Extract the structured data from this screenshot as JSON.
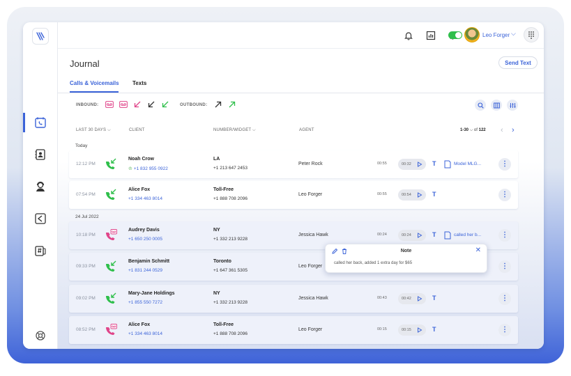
{
  "user": {
    "name": "Leo Forger"
  },
  "header": {
    "title": "Journal",
    "send_text": "Send Text"
  },
  "tabs": [
    {
      "label": "Calls & Voicemails",
      "active": true
    },
    {
      "label": "Texts",
      "active": false
    }
  ],
  "filters": {
    "inbound_label": "INBOUND:",
    "outbound_label": "OUTBOUND:"
  },
  "columns": {
    "period": "LAST 30 DAYS",
    "client": "CLIENT",
    "number": "NUMBER/WIDGET",
    "agent": "AGENT"
  },
  "pager": {
    "range": "1-30",
    "of_label": "of",
    "total": "122"
  },
  "groups": {
    "today": "Today",
    "date": "24 Jul 2022"
  },
  "rows": [
    {
      "time": "12:12 PM",
      "type": "inbound",
      "client": "Noah Crow",
      "phone": "+1 832 955 0922",
      "location": "LA",
      "number": "+1 213 647 2453",
      "agent": "Peter Rock",
      "duration": "00:55",
      "player_time": "00:32",
      "note": "Model MLG..."
    },
    {
      "time": "07:54 PM",
      "type": "inbound",
      "client": "Alice Fox",
      "phone": "+1 334 463 8014",
      "location": "Toll-Free",
      "number": "+1 888 708 2096",
      "agent": "Leo Forger",
      "duration": "00:55",
      "player_time": "00:54",
      "note": ""
    },
    {
      "time": "10:18 PM",
      "type": "voicemail",
      "client": "Audrey Davis",
      "phone": "+1 650 250 0005",
      "location": "NY",
      "number": "+1 332 213 9228",
      "agent": "Jessica Hawk",
      "duration": "00:24",
      "player_time": "00:24",
      "note": "called her b..."
    },
    {
      "time": "09:33 PM",
      "type": "inbound",
      "client": "Benjamin Schmitt",
      "phone": "+1 831 244 0529",
      "location": "Toronto",
      "number": "+1 647 361 5305",
      "agent": "Leo Forger",
      "duration": "",
      "player_time": "",
      "note": ""
    },
    {
      "time": "09:02 PM",
      "type": "inbound",
      "client": "Mary-Jane Holdings",
      "phone": "+1 855 550 7272",
      "location": "NY",
      "number": "+1 332 213 9228",
      "agent": "Jessica Hawk",
      "duration": "00:43",
      "player_time": "00:42",
      "note": ""
    },
    {
      "time": "08:52 PM",
      "type": "voicemail",
      "client": "Alice Fox",
      "phone": "+1 334 463 8014",
      "location": "Toll-Free",
      "number": "+1 888 708 2096",
      "agent": "Leo Forger",
      "duration": "00:15",
      "player_time": "00:15",
      "note": ""
    }
  ],
  "note_popover": {
    "title": "Note",
    "body": "called her back, added 1 extra day for $65"
  },
  "colors": {
    "accent": "#3b63d8",
    "inbound": "#2fbf4b",
    "missed": "#e0458a",
    "toggle": "#2fbf4b"
  }
}
